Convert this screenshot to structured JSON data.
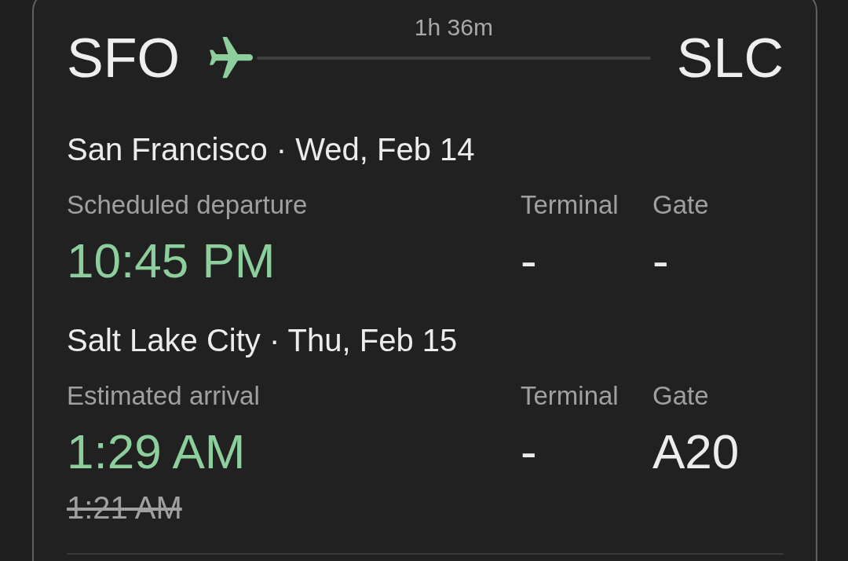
{
  "flight": {
    "origin": "SFO",
    "duration": "1h 36m",
    "destination": "SLC"
  },
  "legs": [
    {
      "place_date": "San Francisco · Wed, Feb 14",
      "time_label": "Scheduled departure",
      "time": "10:45 PM",
      "terminal_label": "Terminal",
      "terminal": "-",
      "gate_label": "Gate",
      "gate": "-"
    },
    {
      "place_date": "Salt Lake City · Thu, Feb 15",
      "time_label": "Estimated arrival",
      "time": "1:29 AM",
      "previous_time": "1:21 AM",
      "terminal_label": "Terminal",
      "terminal": "-",
      "gate_label": "Gate",
      "gate": "A20"
    }
  ]
}
